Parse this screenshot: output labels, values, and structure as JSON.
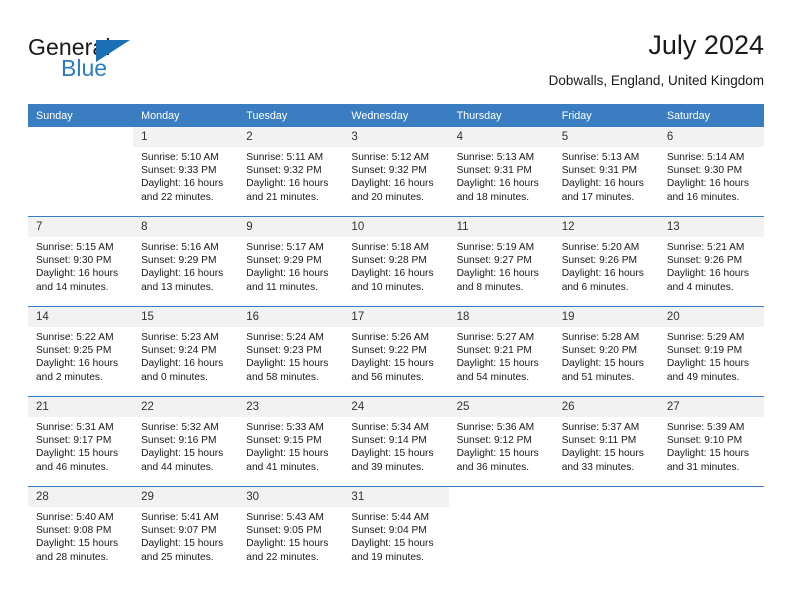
{
  "logo": {
    "word_general": "General",
    "word_blue": "Blue",
    "triangle_color": "#1a6fb5",
    "blue_color": "#2b7cc3"
  },
  "header": {
    "title": "July 2024",
    "subtitle": "Dobwalls, England, United Kingdom"
  },
  "theme": {
    "header_bg": "#3a7ec1",
    "daynum_bg": "#f2f2f2",
    "row_divider": "#3a7ec1",
    "text": "#1a1a1a"
  },
  "calendar": {
    "weekday_headers": [
      "Sunday",
      "Monday",
      "Tuesday",
      "Wednesday",
      "Thursday",
      "Friday",
      "Saturday"
    ],
    "weeks": [
      [
        {
          "day": "",
          "sunrise": "",
          "sunset": "",
          "daylight_line1": "",
          "daylight_line2": "",
          "empty": true
        },
        {
          "day": "1",
          "sunrise": "Sunrise: 5:10 AM",
          "sunset": "Sunset: 9:33 PM",
          "daylight_line1": "Daylight: 16 hours",
          "daylight_line2": "and 22 minutes."
        },
        {
          "day": "2",
          "sunrise": "Sunrise: 5:11 AM",
          "sunset": "Sunset: 9:32 PM",
          "daylight_line1": "Daylight: 16 hours",
          "daylight_line2": "and 21 minutes."
        },
        {
          "day": "3",
          "sunrise": "Sunrise: 5:12 AM",
          "sunset": "Sunset: 9:32 PM",
          "daylight_line1": "Daylight: 16 hours",
          "daylight_line2": "and 20 minutes."
        },
        {
          "day": "4",
          "sunrise": "Sunrise: 5:13 AM",
          "sunset": "Sunset: 9:31 PM",
          "daylight_line1": "Daylight: 16 hours",
          "daylight_line2": "and 18 minutes."
        },
        {
          "day": "5",
          "sunrise": "Sunrise: 5:13 AM",
          "sunset": "Sunset: 9:31 PM",
          "daylight_line1": "Daylight: 16 hours",
          "daylight_line2": "and 17 minutes."
        },
        {
          "day": "6",
          "sunrise": "Sunrise: 5:14 AM",
          "sunset": "Sunset: 9:30 PM",
          "daylight_line1": "Daylight: 16 hours",
          "daylight_line2": "and 16 minutes."
        }
      ],
      [
        {
          "day": "7",
          "sunrise": "Sunrise: 5:15 AM",
          "sunset": "Sunset: 9:30 PM",
          "daylight_line1": "Daylight: 16 hours",
          "daylight_line2": "and 14 minutes."
        },
        {
          "day": "8",
          "sunrise": "Sunrise: 5:16 AM",
          "sunset": "Sunset: 9:29 PM",
          "daylight_line1": "Daylight: 16 hours",
          "daylight_line2": "and 13 minutes."
        },
        {
          "day": "9",
          "sunrise": "Sunrise: 5:17 AM",
          "sunset": "Sunset: 9:29 PM",
          "daylight_line1": "Daylight: 16 hours",
          "daylight_line2": "and 11 minutes."
        },
        {
          "day": "10",
          "sunrise": "Sunrise: 5:18 AM",
          "sunset": "Sunset: 9:28 PM",
          "daylight_line1": "Daylight: 16 hours",
          "daylight_line2": "and 10 minutes."
        },
        {
          "day": "11",
          "sunrise": "Sunrise: 5:19 AM",
          "sunset": "Sunset: 9:27 PM",
          "daylight_line1": "Daylight: 16 hours",
          "daylight_line2": "and 8 minutes."
        },
        {
          "day": "12",
          "sunrise": "Sunrise: 5:20 AM",
          "sunset": "Sunset: 9:26 PM",
          "daylight_line1": "Daylight: 16 hours",
          "daylight_line2": "and 6 minutes."
        },
        {
          "day": "13",
          "sunrise": "Sunrise: 5:21 AM",
          "sunset": "Sunset: 9:26 PM",
          "daylight_line1": "Daylight: 16 hours",
          "daylight_line2": "and 4 minutes."
        }
      ],
      [
        {
          "day": "14",
          "sunrise": "Sunrise: 5:22 AM",
          "sunset": "Sunset: 9:25 PM",
          "daylight_line1": "Daylight: 16 hours",
          "daylight_line2": "and 2 minutes."
        },
        {
          "day": "15",
          "sunrise": "Sunrise: 5:23 AM",
          "sunset": "Sunset: 9:24 PM",
          "daylight_line1": "Daylight: 16 hours",
          "daylight_line2": "and 0 minutes."
        },
        {
          "day": "16",
          "sunrise": "Sunrise: 5:24 AM",
          "sunset": "Sunset: 9:23 PM",
          "daylight_line1": "Daylight: 15 hours",
          "daylight_line2": "and 58 minutes."
        },
        {
          "day": "17",
          "sunrise": "Sunrise: 5:26 AM",
          "sunset": "Sunset: 9:22 PM",
          "daylight_line1": "Daylight: 15 hours",
          "daylight_line2": "and 56 minutes."
        },
        {
          "day": "18",
          "sunrise": "Sunrise: 5:27 AM",
          "sunset": "Sunset: 9:21 PM",
          "daylight_line1": "Daylight: 15 hours",
          "daylight_line2": "and 54 minutes."
        },
        {
          "day": "19",
          "sunrise": "Sunrise: 5:28 AM",
          "sunset": "Sunset: 9:20 PM",
          "daylight_line1": "Daylight: 15 hours",
          "daylight_line2": "and 51 minutes."
        },
        {
          "day": "20",
          "sunrise": "Sunrise: 5:29 AM",
          "sunset": "Sunset: 9:19 PM",
          "daylight_line1": "Daylight: 15 hours",
          "daylight_line2": "and 49 minutes."
        }
      ],
      [
        {
          "day": "21",
          "sunrise": "Sunrise: 5:31 AM",
          "sunset": "Sunset: 9:17 PM",
          "daylight_line1": "Daylight: 15 hours",
          "daylight_line2": "and 46 minutes."
        },
        {
          "day": "22",
          "sunrise": "Sunrise: 5:32 AM",
          "sunset": "Sunset: 9:16 PM",
          "daylight_line1": "Daylight: 15 hours",
          "daylight_line2": "and 44 minutes."
        },
        {
          "day": "23",
          "sunrise": "Sunrise: 5:33 AM",
          "sunset": "Sunset: 9:15 PM",
          "daylight_line1": "Daylight: 15 hours",
          "daylight_line2": "and 41 minutes."
        },
        {
          "day": "24",
          "sunrise": "Sunrise: 5:34 AM",
          "sunset": "Sunset: 9:14 PM",
          "daylight_line1": "Daylight: 15 hours",
          "daylight_line2": "and 39 minutes."
        },
        {
          "day": "25",
          "sunrise": "Sunrise: 5:36 AM",
          "sunset": "Sunset: 9:12 PM",
          "daylight_line1": "Daylight: 15 hours",
          "daylight_line2": "and 36 minutes."
        },
        {
          "day": "26",
          "sunrise": "Sunrise: 5:37 AM",
          "sunset": "Sunset: 9:11 PM",
          "daylight_line1": "Daylight: 15 hours",
          "daylight_line2": "and 33 minutes."
        },
        {
          "day": "27",
          "sunrise": "Sunrise: 5:39 AM",
          "sunset": "Sunset: 9:10 PM",
          "daylight_line1": "Daylight: 15 hours",
          "daylight_line2": "and 31 minutes."
        }
      ],
      [
        {
          "day": "28",
          "sunrise": "Sunrise: 5:40 AM",
          "sunset": "Sunset: 9:08 PM",
          "daylight_line1": "Daylight: 15 hours",
          "daylight_line2": "and 28 minutes."
        },
        {
          "day": "29",
          "sunrise": "Sunrise: 5:41 AM",
          "sunset": "Sunset: 9:07 PM",
          "daylight_line1": "Daylight: 15 hours",
          "daylight_line2": "and 25 minutes."
        },
        {
          "day": "30",
          "sunrise": "Sunrise: 5:43 AM",
          "sunset": "Sunset: 9:05 PM",
          "daylight_line1": "Daylight: 15 hours",
          "daylight_line2": "and 22 minutes."
        },
        {
          "day": "31",
          "sunrise": "Sunrise: 5:44 AM",
          "sunset": "Sunset: 9:04 PM",
          "daylight_line1": "Daylight: 15 hours",
          "daylight_line2": "and 19 minutes."
        },
        {
          "day": "",
          "sunrise": "",
          "sunset": "",
          "daylight_line1": "",
          "daylight_line2": "",
          "empty": true
        },
        {
          "day": "",
          "sunrise": "",
          "sunset": "",
          "daylight_line1": "",
          "daylight_line2": "",
          "empty": true
        },
        {
          "day": "",
          "sunrise": "",
          "sunset": "",
          "daylight_line1": "",
          "daylight_line2": "",
          "empty": true
        }
      ]
    ]
  }
}
